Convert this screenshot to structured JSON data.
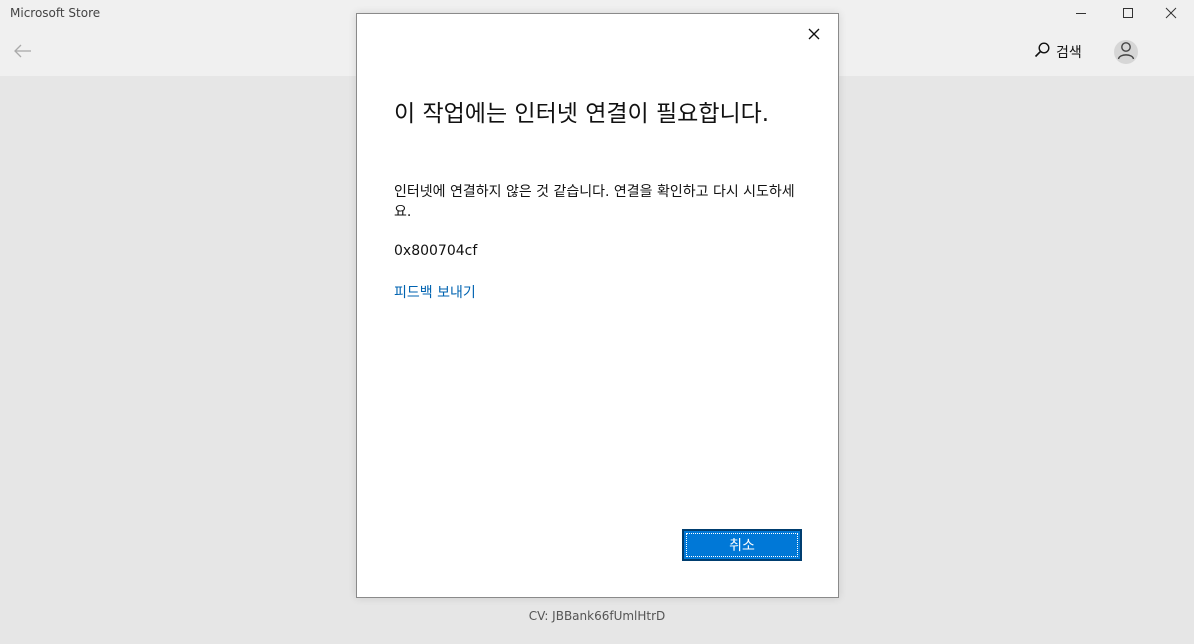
{
  "window": {
    "title": "Microsoft Store",
    "minimize_icon": "minimize-icon",
    "maximize_icon": "maximize-icon",
    "close_icon": "close-icon"
  },
  "nav": {
    "back_icon": "arrow-left-icon",
    "search_label": "검색",
    "search_icon": "search-icon",
    "avatar_icon": "user-icon"
  },
  "dialog": {
    "title": "이 작업에는 인터넷 연결이 필요합니다.",
    "message": "인터넷에 연결하지 않은 것 같습니다. 연결을 확인하고 다시 시도하세요.",
    "error_code": "0x800704cf",
    "feedback_link": "피드백 보내기",
    "cancel_label": "취소",
    "close_icon": "close-icon"
  },
  "footer": {
    "cv_text": "CV: JBBank66fUmlHtrD"
  },
  "colors": {
    "accent": "#0078d7",
    "link": "#0063b1",
    "background": "#e6e6e6"
  }
}
